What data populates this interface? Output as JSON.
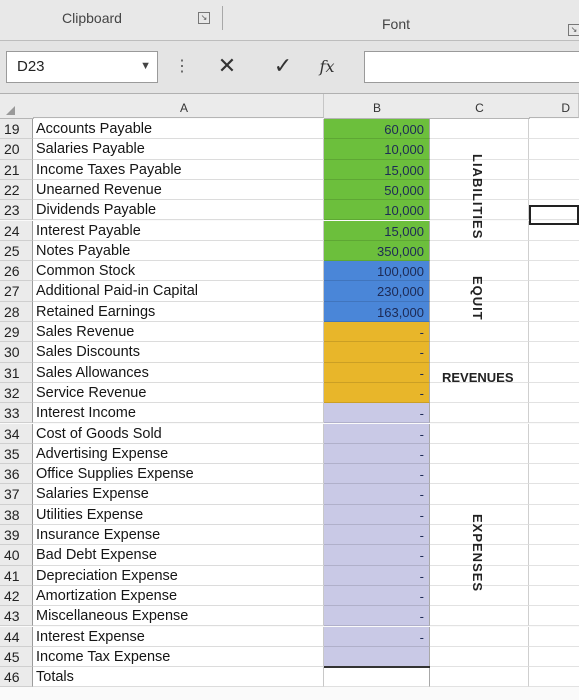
{
  "ribbon": {
    "clipboard_label": "Clipboard",
    "font_label": "Font"
  },
  "formula_bar": {
    "name_box": "D23",
    "formula": "",
    "cancel_icon": "close-icon",
    "enter_icon": "check-icon",
    "fx_label": "fx"
  },
  "columns": [
    "A",
    "B",
    "C",
    "D"
  ],
  "rows": [
    {
      "num": "19",
      "label": "Accounts Payable",
      "value": "60,000",
      "fill": "green"
    },
    {
      "num": "20",
      "label": "Salaries Payable",
      "value": "10,000",
      "fill": "green"
    },
    {
      "num": "21",
      "label": "Income Taxes Payable",
      "value": "15,000",
      "fill": "green"
    },
    {
      "num": "22",
      "label": "Unearned Revenue",
      "value": "50,000",
      "fill": "green"
    },
    {
      "num": "23",
      "label": "Dividends Payable",
      "value": "10,000",
      "fill": "green"
    },
    {
      "num": "24",
      "label": "Interest Payable",
      "value": "15,000",
      "fill": "green"
    },
    {
      "num": "25",
      "label": "Notes Payable",
      "value": "350,000",
      "fill": "green"
    },
    {
      "num": "26",
      "label": "Common Stock",
      "value": "100,000",
      "fill": "blue"
    },
    {
      "num": "27",
      "label": "Additional Paid-in Capital",
      "value": "230,000",
      "fill": "blue"
    },
    {
      "num": "28",
      "label": "Retained Earnings",
      "value": "163,000",
      "fill": "blue"
    },
    {
      "num": "29",
      "label": "Sales Revenue",
      "value": "-",
      "fill": "yellow"
    },
    {
      "num": "30",
      "label": "Sales Discounts",
      "value": "-",
      "fill": "yellow"
    },
    {
      "num": "31",
      "label": "Sales Allowances",
      "value": "-",
      "fill": "yellow"
    },
    {
      "num": "32",
      "label": "Service Revenue",
      "value": "-",
      "fill": "yellow"
    },
    {
      "num": "33",
      "label": "Interest Income",
      "value": "-",
      "fill": "lav"
    },
    {
      "num": "34",
      "label": "Cost of Goods Sold",
      "value": "-",
      "fill": "lav"
    },
    {
      "num": "35",
      "label": "Advertising Expense",
      "value": "-",
      "fill": "lav"
    },
    {
      "num": "36",
      "label": "Office Supplies Expense",
      "value": "-",
      "fill": "lav"
    },
    {
      "num": "37",
      "label": "Salaries Expense",
      "value": "-",
      "fill": "lav"
    },
    {
      "num": "38",
      "label": "Utilities Expense",
      "value": "-",
      "fill": "lav"
    },
    {
      "num": "39",
      "label": "Insurance Expense",
      "value": "-",
      "fill": "lav"
    },
    {
      "num": "40",
      "label": "Bad Debt Expense",
      "value": "-",
      "fill": "lav"
    },
    {
      "num": "41",
      "label": "Depreciation Expense",
      "value": "-",
      "fill": "lav"
    },
    {
      "num": "42",
      "label": "Amortization Expense",
      "value": "-",
      "fill": "lav"
    },
    {
      "num": "43",
      "label": "Miscellaneous Expense",
      "value": "-",
      "fill": "lav"
    },
    {
      "num": "44",
      "label": "Interest Expense",
      "value": "-",
      "fill": "lav"
    },
    {
      "num": "45",
      "label": "Income Tax Expense",
      "value": "",
      "fill": "lav"
    },
    {
      "num": "46",
      "label": "Totals",
      "value": "",
      "fill": "none"
    }
  ],
  "section_labels": {
    "liabilities": "LIABILITIES",
    "equity": "EQUIT",
    "revenues": "REVENUES",
    "expenses": "EXPENSES"
  },
  "colors": {
    "green": "#6cbf3c",
    "blue": "#4a86d8",
    "yellow": "#e8b62a",
    "lavender": "#c9c9e6"
  }
}
